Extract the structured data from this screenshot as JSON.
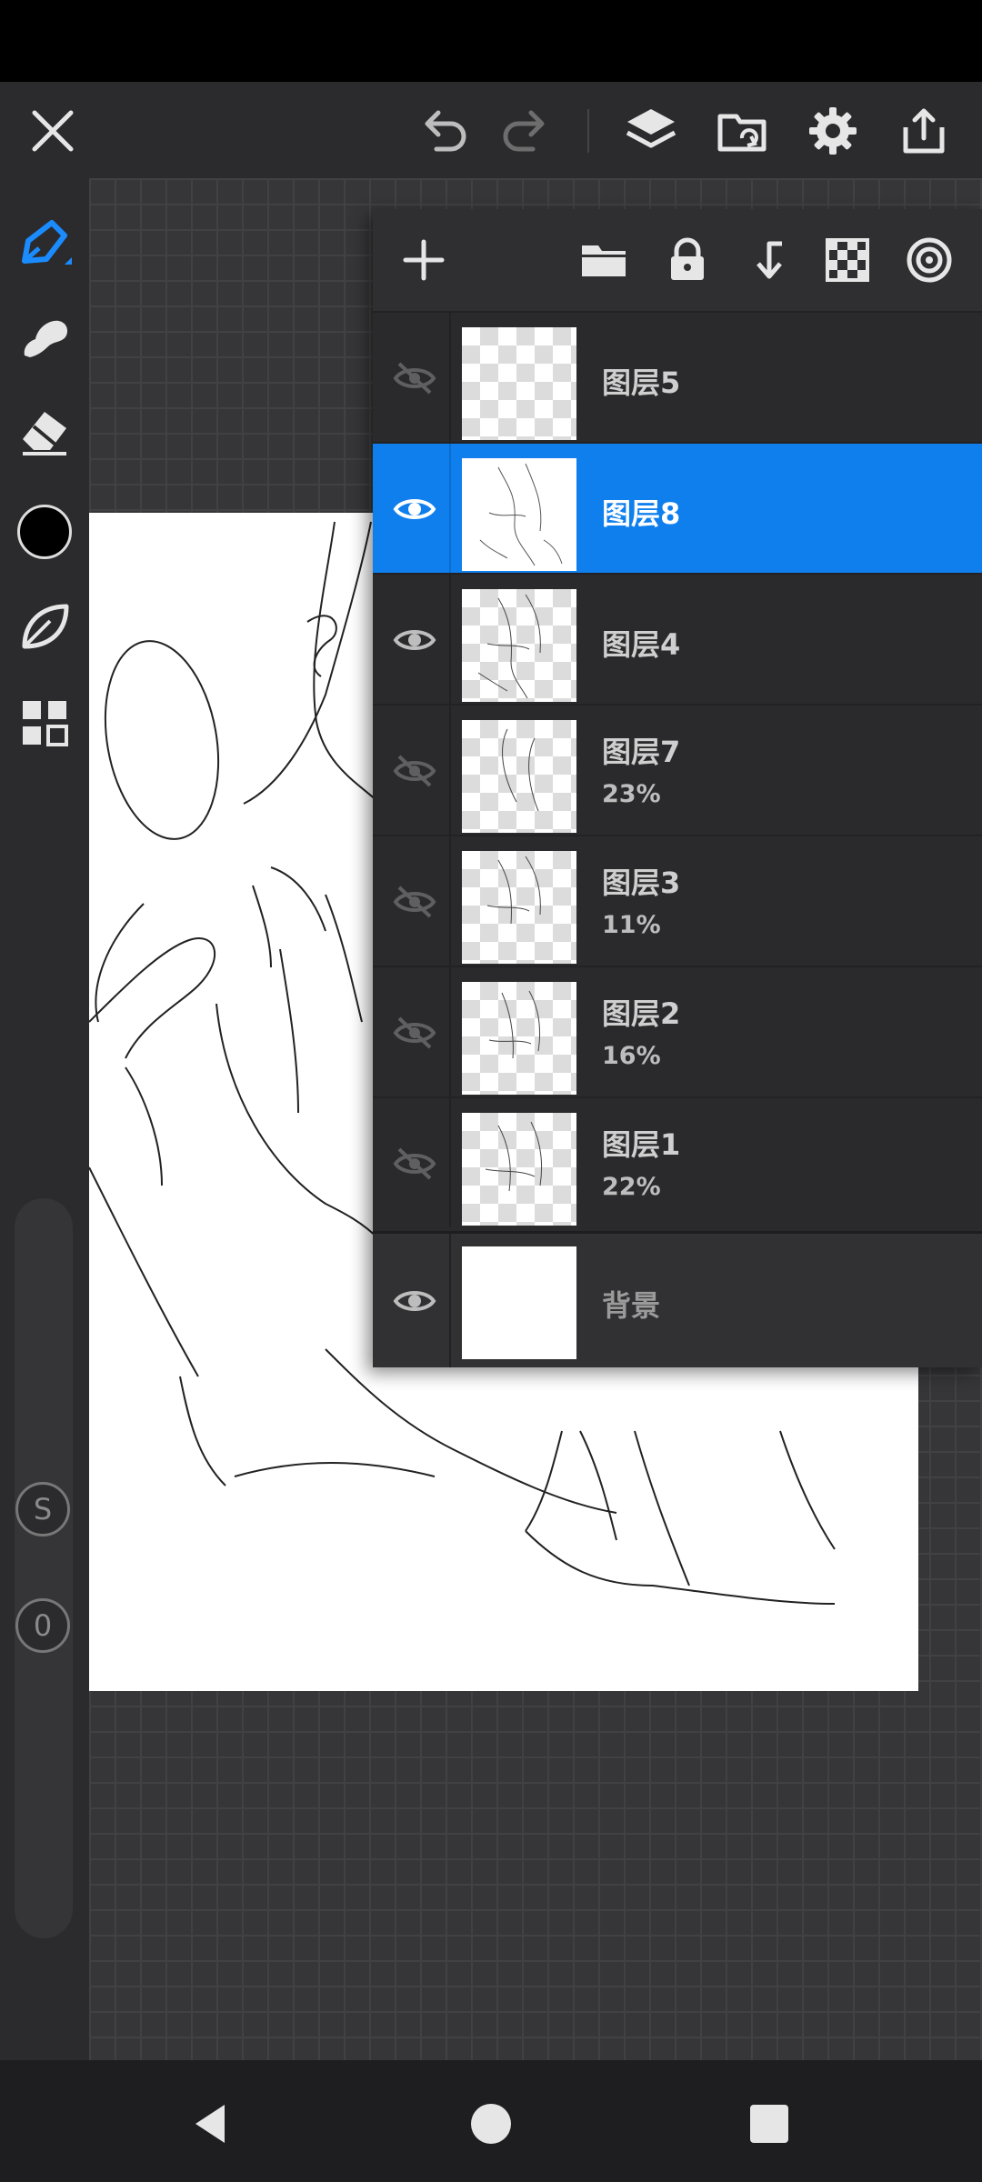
{
  "toolbar": {
    "close_icon": "close-icon",
    "undo_icon": "undo-icon",
    "redo_icon": "redo-icon",
    "layers_icon": "layers-icon",
    "import_icon": "folder-import-icon",
    "settings_icon": "gear-icon",
    "share_icon": "share-icon"
  },
  "tools": [
    {
      "name": "pen-tool",
      "icon": "pen-icon",
      "active": true
    },
    {
      "name": "smudge-tool",
      "icon": "smudge-icon",
      "active": false
    },
    {
      "name": "eraser-tool",
      "icon": "eraser-icon",
      "active": false
    },
    {
      "name": "color-swatch",
      "icon": "color-swatch",
      "active": false
    },
    {
      "name": "leaf-tool",
      "icon": "leaf-icon",
      "active": false
    },
    {
      "name": "grid-tool",
      "icon": "grid-icon",
      "active": false
    }
  ],
  "colors": {
    "current_color": "#000000",
    "accent": "#0f7fee"
  },
  "slider": {
    "size_label": "S",
    "opacity_label": "0"
  },
  "layers_panel": {
    "actions": [
      "add-layer",
      "folder",
      "lock",
      "merge-down",
      "transparency-lock",
      "clipping"
    ],
    "layers": [
      {
        "name": "图层5",
        "opacity": "",
        "visible": false,
        "selected": false,
        "thumb": "empty"
      },
      {
        "name": "图层8",
        "opacity": "",
        "visible": true,
        "selected": true,
        "thumb": "sketch"
      },
      {
        "name": "图层4",
        "opacity": "",
        "visible": true,
        "selected": false,
        "thumb": "sketch"
      },
      {
        "name": "图层7",
        "opacity": "23%",
        "visible": false,
        "selected": false,
        "thumb": "sketch"
      },
      {
        "name": "图层3",
        "opacity": "11%",
        "visible": false,
        "selected": false,
        "thumb": "sketch"
      },
      {
        "name": "图层2",
        "opacity": "16%",
        "visible": false,
        "selected": false,
        "thumb": "sketch"
      },
      {
        "name": "图层1",
        "opacity": "22%",
        "visible": false,
        "selected": false,
        "thumb": "sketch"
      },
      {
        "name": "背景",
        "opacity": "",
        "visible": true,
        "selected": false,
        "thumb": "white"
      }
    ]
  },
  "navbar": {
    "back_icon": "back-triangle-icon",
    "home_icon": "home-circle-icon",
    "recents_icon": "recents-square-icon"
  }
}
